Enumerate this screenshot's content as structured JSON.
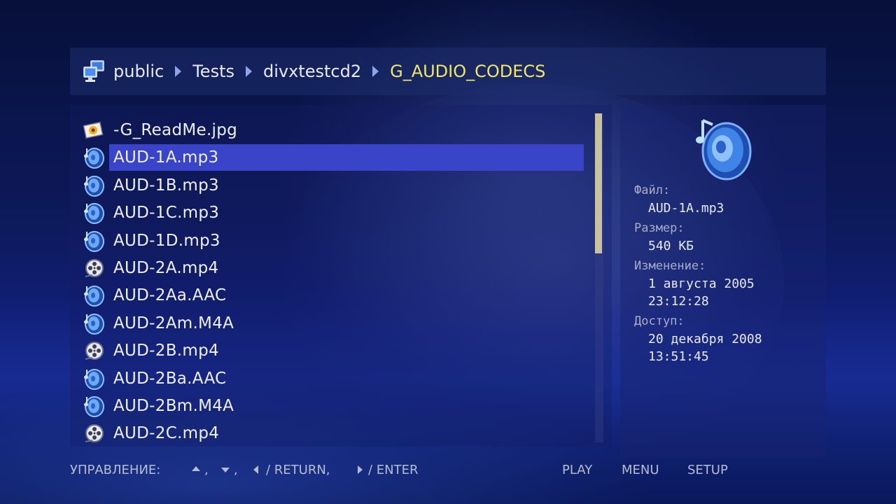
{
  "breadcrumb": {
    "icon": "network-computer-icon",
    "items": [
      "public",
      "Tests",
      "divxtestcd2",
      "G_AUDIO_CODECS"
    ]
  },
  "files": [
    {
      "name": "-G_ReadMe.jpg",
      "icon": "image-file-icon"
    },
    {
      "name": "AUD-1A.mp3",
      "icon": "audio-file-icon",
      "selected": true
    },
    {
      "name": "AUD-1B.mp3",
      "icon": "audio-file-icon"
    },
    {
      "name": "AUD-1C.mp3",
      "icon": "audio-file-icon"
    },
    {
      "name": "AUD-1D.mp3",
      "icon": "audio-file-icon"
    },
    {
      "name": "AUD-2A.mp4",
      "icon": "video-file-icon"
    },
    {
      "name": "AUD-2Aa.AAC",
      "icon": "audio-file-icon"
    },
    {
      "name": "AUD-2Am.M4A",
      "icon": "audio-file-icon"
    },
    {
      "name": "AUD-2B.mp4",
      "icon": "video-file-icon"
    },
    {
      "name": "AUD-2Ba.AAC",
      "icon": "audio-file-icon"
    },
    {
      "name": "AUD-2Bm.M4A",
      "icon": "audio-file-icon"
    },
    {
      "name": "AUD-2C.mp4",
      "icon": "video-file-icon"
    }
  ],
  "info": {
    "icon": "speaker-music-icon",
    "file_label": "Файл:",
    "file_value": "AUD-1A.mp3",
    "size_label": "Размер:",
    "size_value": "540 КБ",
    "modified_label": "Изменение:",
    "modified_date": "1 августа 2005",
    "modified_time": "23:12:28",
    "access_label": "Доступ:",
    "access_date": "20 декабря 2008",
    "access_time": "13:51:45"
  },
  "footer": {
    "controls_label": "УПРАВЛЕНИЕ:",
    "comma1": ",",
    "comma2": ",",
    "return_label": "/ RETURN,",
    "enter_label": "/ ENTER",
    "play": "PLAY",
    "menu": "MENU",
    "setup": "SETUP"
  },
  "colors": {
    "selection": "#3a44c8",
    "current_crumb": "#f0e66a"
  }
}
